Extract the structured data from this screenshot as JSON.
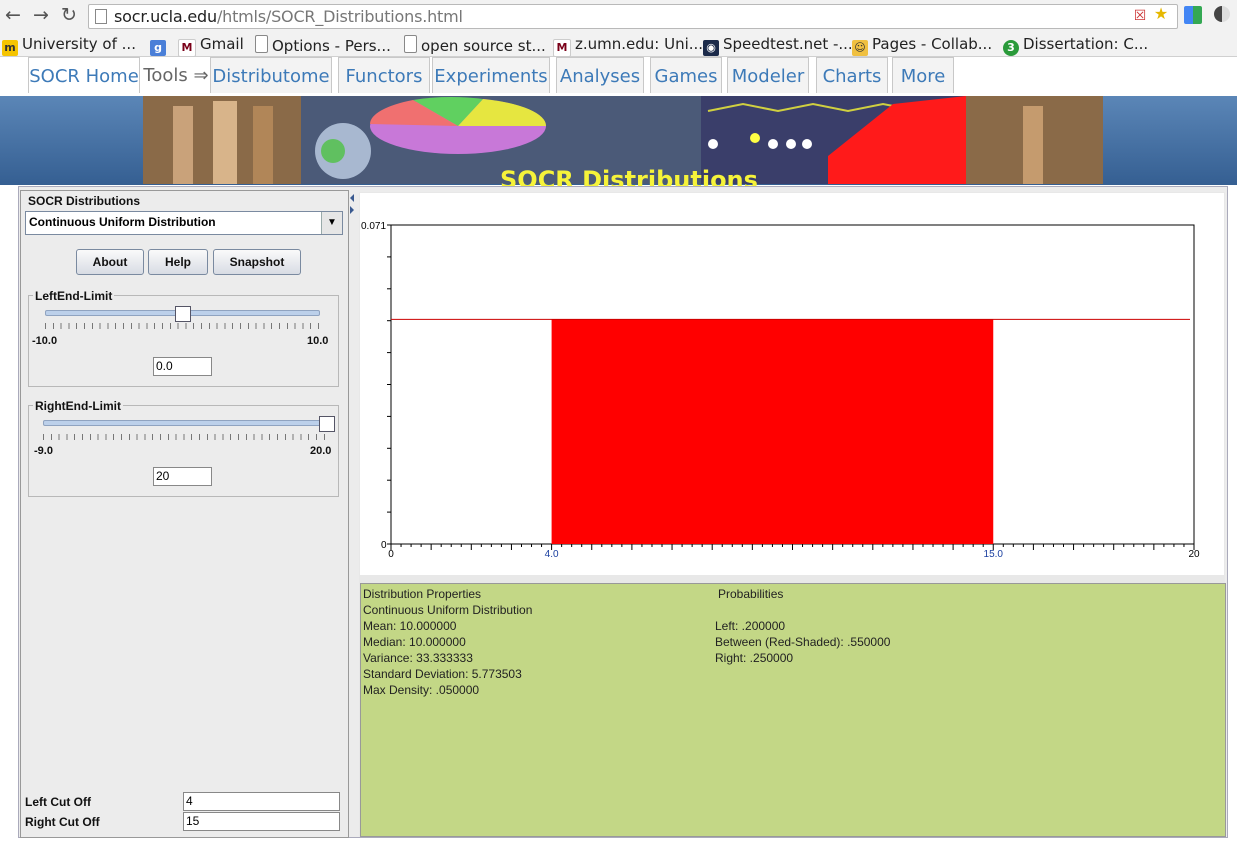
{
  "browser": {
    "url_host": "socr.ucla.edu",
    "url_path": "/htmls/SOCR_Distributions.html",
    "bookmarks": [
      {
        "label": "University of ...",
        "icon": "university-icon"
      },
      {
        "label": "",
        "icon": "google-icon"
      },
      {
        "label": "Gmail",
        "icon": "gmail-icon"
      },
      {
        "label": "Options - Pers...",
        "icon": "page-icon"
      },
      {
        "label": "open source st...",
        "icon": "page-icon"
      },
      {
        "label": "z.umn.edu: Uni...",
        "icon": "umn-icon"
      },
      {
        "label": "Speedtest.net -...",
        "icon": "speedtest-icon"
      },
      {
        "label": "Pages - Collab...",
        "icon": "pages-icon"
      },
      {
        "label": "Dissertation: C...",
        "icon": "dissertation-icon"
      }
    ]
  },
  "nav": {
    "tabs": [
      "SOCR Home",
      "Tools ⇒",
      "Distributome",
      "Functors",
      "Experiments",
      "Analyses",
      "Games",
      "Modeler",
      "Charts",
      "More"
    ]
  },
  "banner": {
    "title": "SOCR Distributions"
  },
  "panel": {
    "title": "SOCR Distributions",
    "selected_distribution": "Continuous Uniform Distribution",
    "buttons": {
      "about": "About",
      "help": "Help",
      "snapshot": "Snapshot"
    },
    "left_limit": {
      "label": "LeftEnd-Limit",
      "min": "-10.0",
      "max": "10.0",
      "value": "0.0",
      "fraction": 0.5
    },
    "right_limit": {
      "label": "RightEnd-Limit",
      "min": "-9.0",
      "max": "20.0",
      "value": "20",
      "fraction": 1.0
    },
    "left_cutoff_label": "Left Cut Off",
    "left_cutoff_value": "4",
    "right_cutoff_label": "Right Cut Off",
    "right_cutoff_value": "15"
  },
  "chart_data": {
    "type": "area",
    "title": "",
    "xlabel": "",
    "ylabel": "",
    "xlim": [
      0,
      20
    ],
    "ylim": [
      0,
      0.071
    ],
    "density": 0.05,
    "shaded_from": 4.0,
    "shaded_to": 15.0,
    "tick_labels": [
      "0",
      "4.0",
      "15.0",
      "20"
    ],
    "y_top_label": "0.071",
    "y_bottom_label": "0",
    "colors": {
      "shade": "#ff0000",
      "line": "#cc0000",
      "tick_highlight": "#1a3fa0"
    }
  },
  "properties": {
    "header": "Distribution Properties",
    "name": "Continuous Uniform Distribution",
    "mean": "Mean: 10.000000",
    "median": "Median: 10.000000",
    "variance": "Variance: 33.333333",
    "sd": "Standard Deviation: 5.773503",
    "max_density": "Max Density: .050000"
  },
  "probabilities": {
    "header": "Probabilities",
    "left": "Left: .200000",
    "between": "Between (Red-Shaded): .550000",
    "right": "Right: .250000"
  }
}
